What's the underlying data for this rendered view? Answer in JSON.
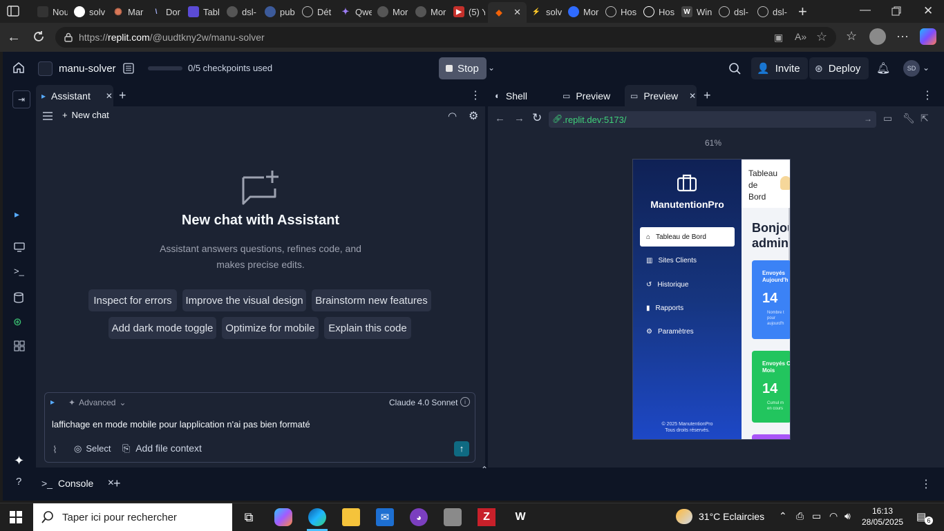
{
  "browser": {
    "tabs": [
      "Nou",
      "solv",
      "Mar",
      "Dor",
      "Tabl",
      "dsl-",
      "pub",
      "Dét",
      "Qwe",
      "Mor",
      "Mor",
      "(5) Y",
      "",
      "solv",
      "Mor",
      "Hos",
      "Hos",
      "Win",
      "dsl-",
      "dsl-"
    ],
    "url_prefix": "https://",
    "url_host": "replit.com",
    "url_path": "/@uudtkny2w/manu-solver"
  },
  "replit": {
    "project_name": "manu-solver",
    "checkpoints": "0/5 checkpoints used",
    "stop_label": "Stop",
    "invite_label": "Invite",
    "deploy_label": "Deploy",
    "avatar_initials": "SD"
  },
  "assistant": {
    "tab_label": "Assistant",
    "new_chat_label": "New chat",
    "heading": "New chat with Assistant",
    "desc_line1": "Assistant answers questions, refines code, and",
    "desc_line2": "makes precise edits.",
    "suggestions": [
      "Inspect for errors",
      "Improve the visual design",
      "Brainstorm new features",
      "Add dark mode toggle",
      "Optimize for mobile",
      "Explain this code"
    ],
    "mode_label": "Advanced",
    "model_label": "Claude 4.0 Sonnet",
    "input_value": "laffichage en mode mobile pour lapplication n'ai  pas bien formaté",
    "select_label": "Select",
    "add_context_label": "Add file context"
  },
  "preview": {
    "tabs": [
      "Shell",
      "Preview",
      "Preview"
    ],
    "url": ".replit.dev:5173/",
    "zoom": "61%",
    "app": {
      "brand": "ManutentionPro",
      "nav": [
        "Tableau de Bord",
        "Sites Clients",
        "Historique",
        "Rapports",
        "Paramètres"
      ],
      "header_title_lines": [
        "Tableau",
        "de",
        "Bord"
      ],
      "greeting_lines": [
        "Bonjou",
        "admin"
      ],
      "card1_title_lines": [
        "Envoyés",
        "Aujourd'h"
      ],
      "card1_value": "14",
      "card1_sub": [
        "Nombre t",
        "pour",
        "aujourd'h"
      ],
      "card2_title_lines": [
        "Envoyés C",
        "Mois"
      ],
      "card2_value": "14",
      "card2_sub": [
        "Cumul m",
        "en cours"
      ],
      "footer_lines": [
        "© 2025 ManutentionPro",
        "Tous droits réservés."
      ]
    }
  },
  "console": {
    "tab_label": "Console"
  },
  "taskbar": {
    "search_placeholder": "Taper ici pour rechercher",
    "weather": "31°C  Eclaircies",
    "time": "16:13",
    "date": "28/05/2025",
    "notification_count": "6"
  },
  "colors": {
    "accent": "#0079f2",
    "replit_bg": "#0e1525",
    "panel_bg": "#1c2333",
    "send": "#0f6a82"
  }
}
